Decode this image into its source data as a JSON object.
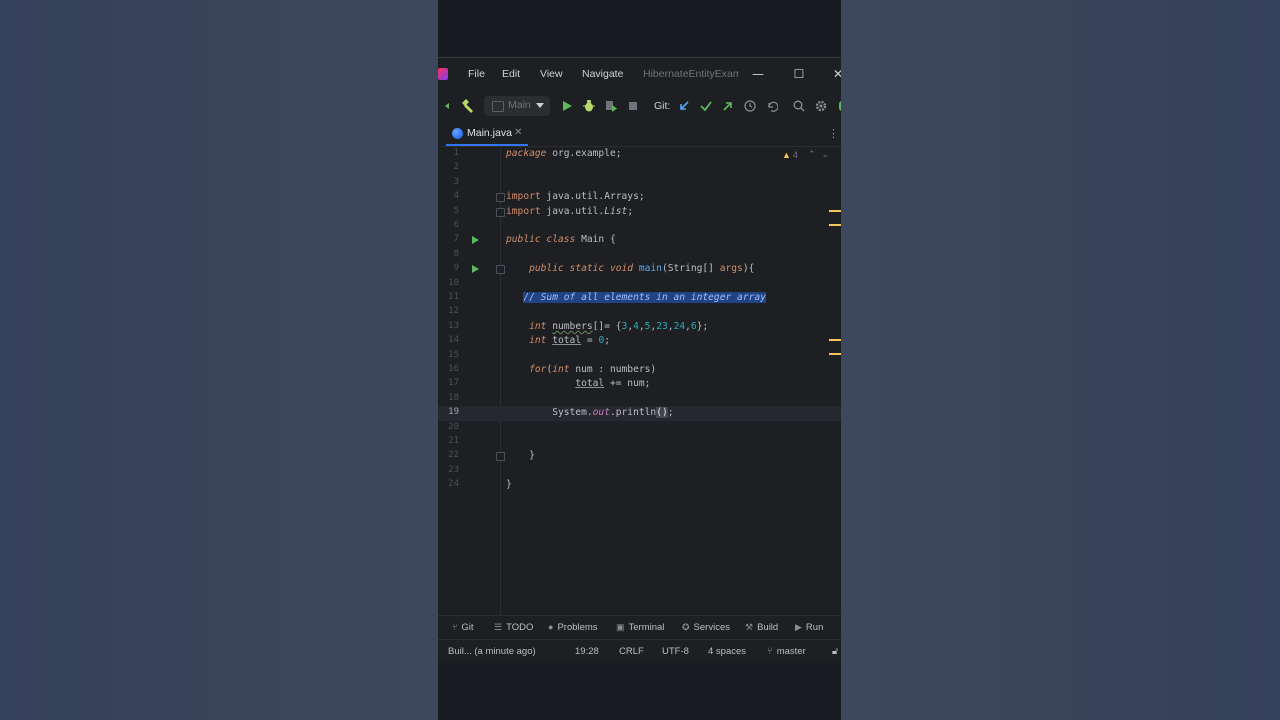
{
  "menu": {
    "file": "File",
    "edit": "Edit",
    "view": "View",
    "navigate": "Navigate",
    "project_title": "HibernateEntityExamp"
  },
  "window_controls": {
    "minimize": "—",
    "maximize": "☐",
    "close": "✕"
  },
  "toolbar": {
    "run_config": "Main",
    "git_label": "Git:"
  },
  "tabs": [
    {
      "label": "Main.java",
      "close": "✕"
    }
  ],
  "editor": {
    "warnings_count": "4",
    "current_line": 19,
    "line_numbers": [
      "1",
      "2",
      "3",
      "4",
      "5",
      "6",
      "7",
      "8",
      "9",
      "10",
      "11",
      "12",
      "13",
      "14",
      "15",
      "16",
      "17",
      "18",
      "19",
      "20",
      "21",
      "22",
      "23",
      "24"
    ],
    "lines": [
      "package org.example;",
      "",
      "",
      "import java.util.Arrays;",
      "import java.util.List;",
      "",
      "public class Main {",
      "",
      "    public static void main(String[] args){",
      "",
      "    // Sum of all elements in an integer array",
      "",
      "    int numbers[]= {3,4,5,23,24,6};",
      "    int total = 0;",
      "",
      "    for(int num : numbers)",
      "            total += num;",
      "",
      "        System.out.println();",
      "",
      "",
      "    }",
      "",
      "}"
    ]
  },
  "tool_windows": [
    {
      "icon": "git-branch-icon",
      "label": "Git"
    },
    {
      "icon": "todo-icon",
      "label": "TODO"
    },
    {
      "icon": "problems-icon",
      "label": "Problems"
    },
    {
      "icon": "terminal-icon",
      "label": "Terminal"
    },
    {
      "icon": "services-icon",
      "label": "Services"
    },
    {
      "icon": "build-icon",
      "label": "Build"
    },
    {
      "icon": "run-icon",
      "label": "Run"
    }
  ],
  "status": {
    "build_status": "Buil... (a minute ago)",
    "caret_position": "19:28",
    "line_separator": "CRLF",
    "encoding": "UTF-8",
    "indent": "4 spaces",
    "branch": "master"
  },
  "colors": {
    "accent": "#3574f0",
    "run_green": "#5fb85f",
    "keyword": "#cf8e6d",
    "number": "#2aacb8",
    "warning": "#f2c55c",
    "selection": "#214283"
  }
}
